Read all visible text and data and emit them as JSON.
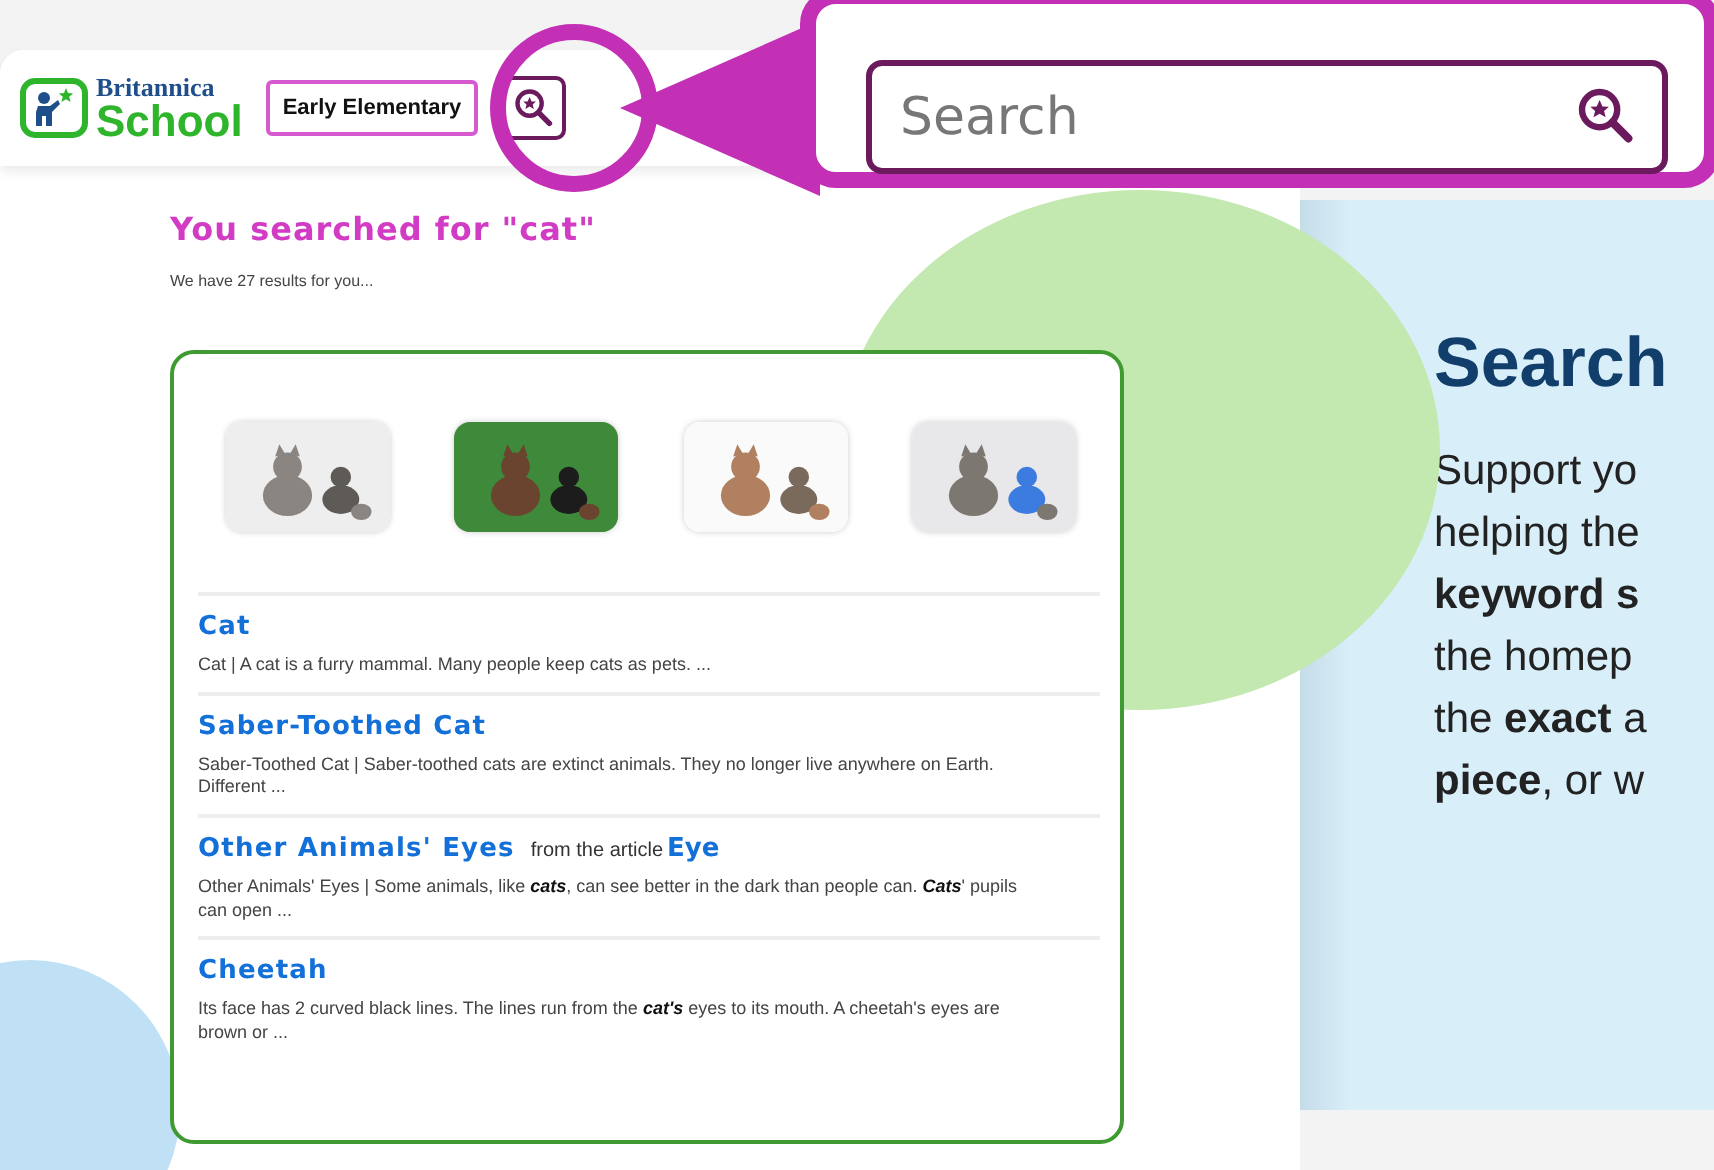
{
  "header": {
    "logo": {
      "line1": "Britannica",
      "line2": "School"
    },
    "level_select": {
      "value": "Early Elementary"
    }
  },
  "callout": {
    "search": {
      "placeholder": "Search"
    }
  },
  "results": {
    "heading": "You searched for \"cat\"",
    "summary": "We have 27 results for you...",
    "items": [
      {
        "title": "Cat",
        "snippet": "Cat  |   A cat is a furry mammal. Many people keep cats as pets.  ..."
      },
      {
        "title": "Saber-Toothed Cat",
        "snippet": "Saber-Toothed Cat  |   Saber-toothed cats are extinct animals. They no longer live anywhere on Earth. Different ..."
      },
      {
        "title": "Other Animals' Eyes",
        "from": "from the article",
        "article": "Eye",
        "snippet": "Other Animals' Eyes  | Some animals, like **cats**, can see better in the dark than people can. **Cats**' pupils can open ..."
      },
      {
        "title": "Cheetah",
        "snippet": "Its face has 2 curved black lines. The lines run from the **cat's** eyes to its mouth. A cheetah's eyes are brown or ..."
      }
    ]
  },
  "panel": {
    "title": "Search",
    "lines": [
      "Support yo",
      "helping the",
      "**keyword s**",
      "the homep",
      "the **exact** a",
      "**piece**, or w"
    ]
  }
}
